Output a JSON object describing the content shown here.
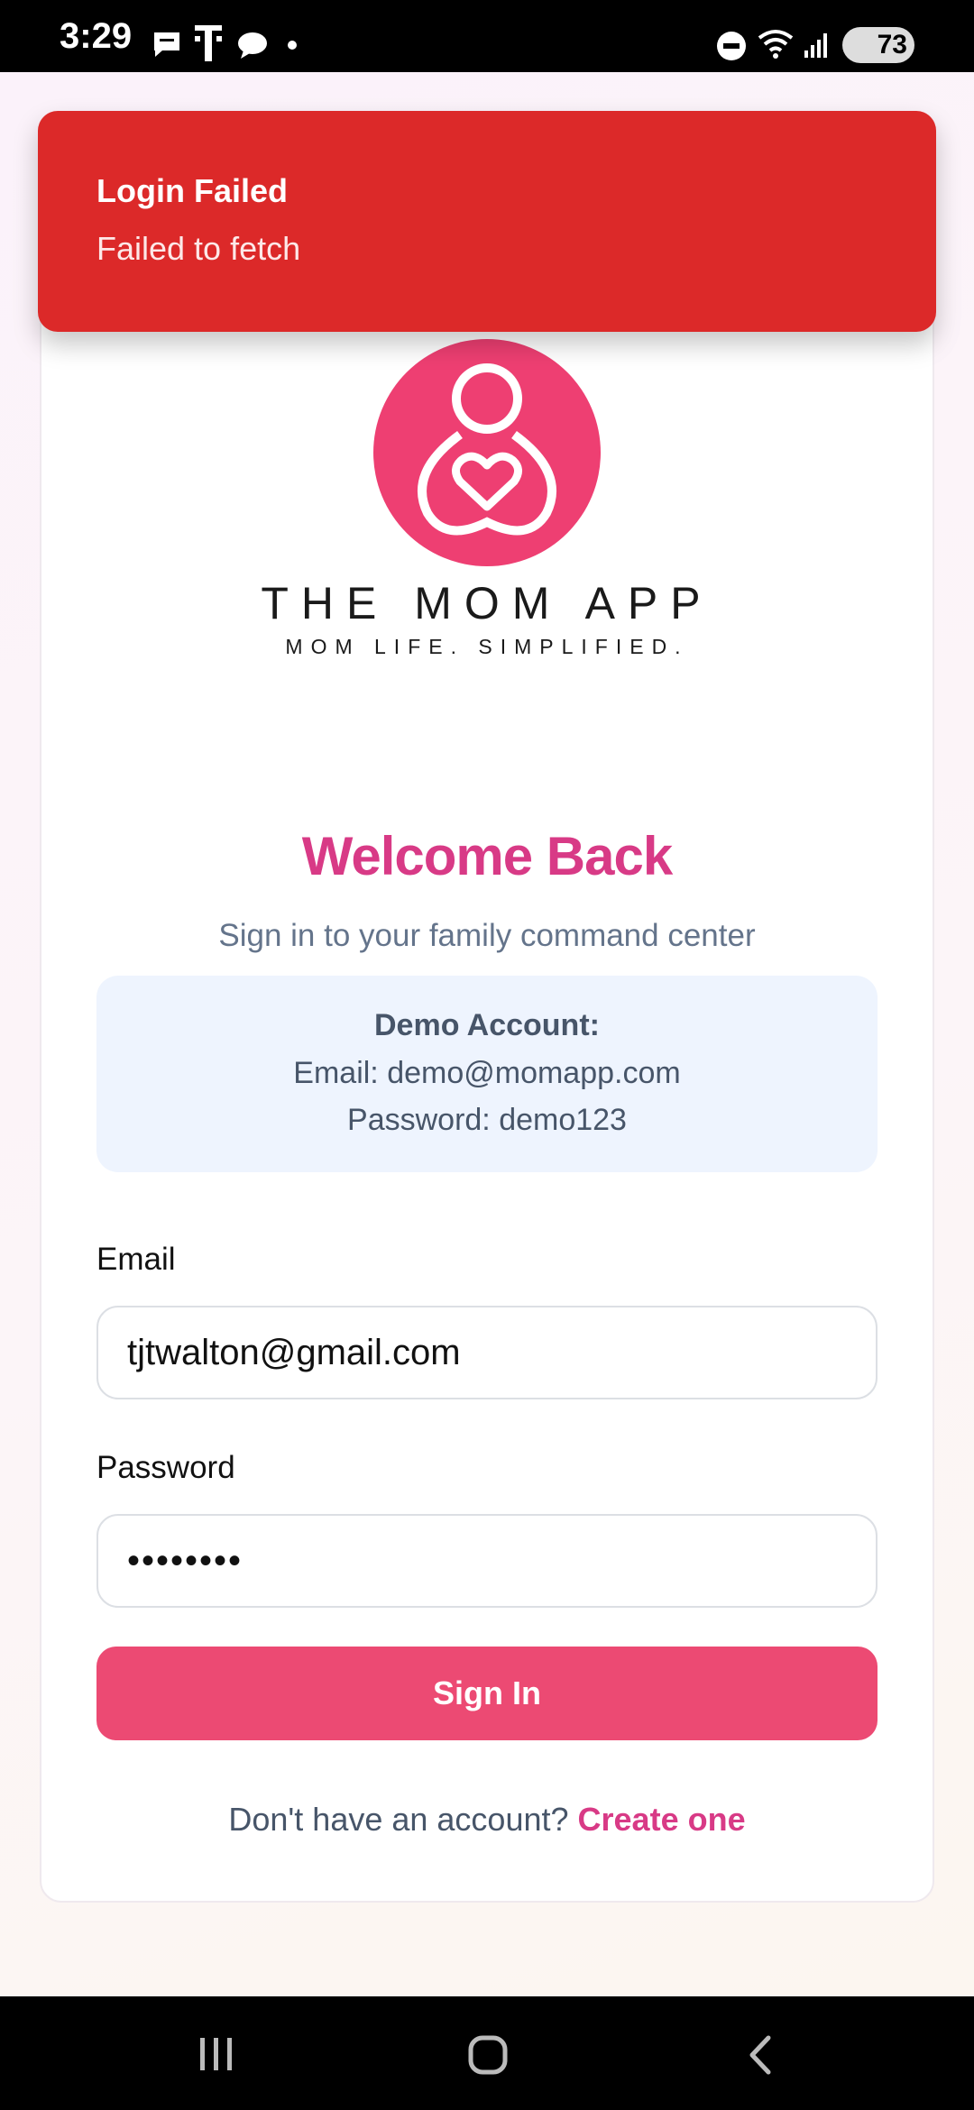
{
  "status_bar": {
    "time": "3:29",
    "battery": "73",
    "icons": [
      "chat-icon",
      "t-mobile-icon",
      "messenger-icon",
      "dot-icon",
      "dnd-icon",
      "wifi-icon",
      "signal-icon",
      "battery-icon"
    ]
  },
  "toast": {
    "title": "Login Failed",
    "message": "Failed to fetch",
    "color": "#dc2929"
  },
  "brand": {
    "name": "THE MOM APP",
    "tagline": "MOM LIFE. SIMPLIFIED.",
    "logo_color": "#ee3f72"
  },
  "login": {
    "title": "Welcome Back",
    "subtitle": "Sign in to your family command center",
    "demo": {
      "title": "Demo Account:",
      "email_line": "Email: demo@momapp.com",
      "password_line": "Password: demo123"
    },
    "email_label": "Email",
    "email_value": "tjtwalton@gmail.com",
    "password_label": "Password",
    "password_value": "••••••••",
    "signin_label": "Sign In",
    "footer_text": "Don't have an account?",
    "footer_link": "Create one"
  },
  "colors": {
    "accent": "#d83a86",
    "button": "#ec4a73",
    "error": "#dc2929"
  },
  "nav_bar": {
    "icons": [
      "recents-icon",
      "home-icon",
      "back-icon"
    ]
  }
}
